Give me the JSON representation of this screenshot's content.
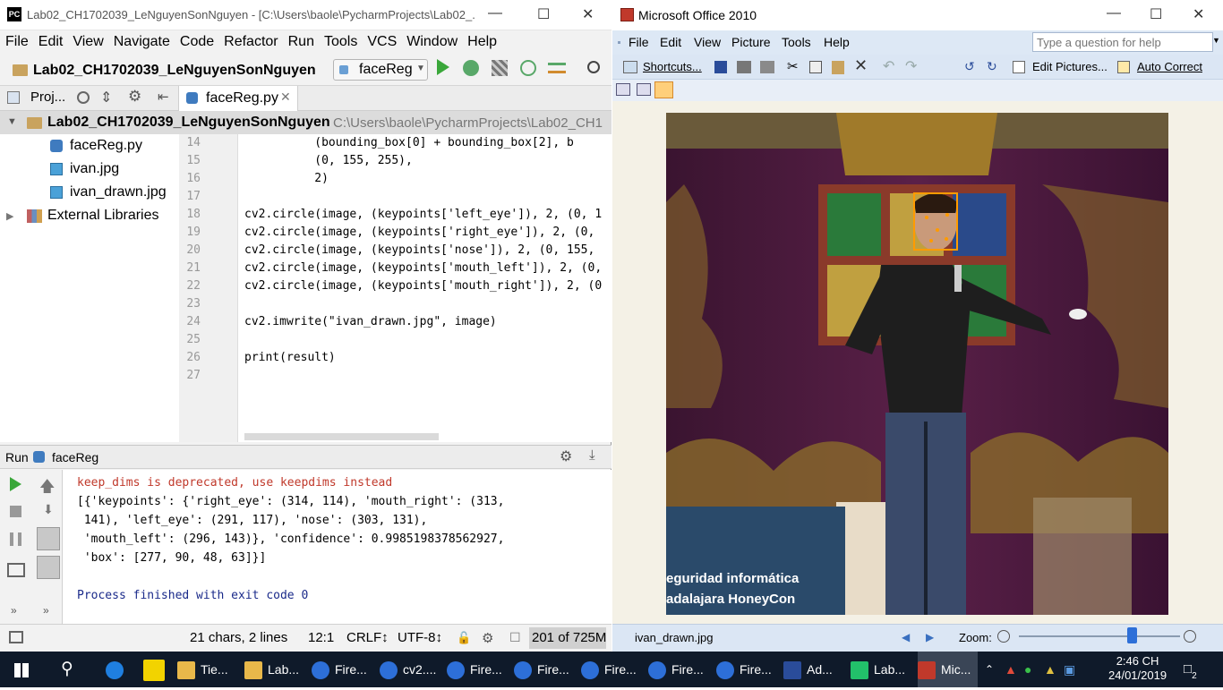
{
  "pycharm": {
    "title": "Lab02_CH1702039_LeNguyenSonNguyen - [C:\\Users\\baole\\PycharmProjects\\Lab02_...",
    "logo": "PC",
    "menu": [
      "File",
      "Edit",
      "View",
      "Navigate",
      "Code",
      "Refactor",
      "Run",
      "Tools",
      "VCS",
      "Window",
      "Help"
    ],
    "project_name": "Lab02_CH1702039_LeNguyenSonNguyen",
    "run_config": "faceReg",
    "proj_tab": "Proj...",
    "file_tab": "faceReg.py",
    "tree_root": "Lab02_CH1702039_LeNguyenSonNguyen",
    "tree_root_path": "C:\\Users\\baole\\PycharmProjects\\Lab02_CH1",
    "files": [
      "faceReg.py",
      "ivan.jpg",
      "ivan_drawn.jpg"
    ],
    "external": "External Libraries",
    "line_numbers": [
      "14",
      "15",
      "16",
      "17",
      "18",
      "19",
      "20",
      "21",
      "22",
      "23",
      "24",
      "25",
      "26",
      "27"
    ],
    "code_lines": [
      "          (bounding_box[0] + bounding_box[2], b",
      "          (0, 155, 255),",
      "          2)",
      "",
      "cv2.circle(image, (keypoints['left_eye']), 2, (0, 1",
      "cv2.circle(image, (keypoints['right_eye']), 2, (0,",
      "cv2.circle(image, (keypoints['nose']), 2, (0, 155,",
      "cv2.circle(image, (keypoints['mouth_left']), 2, (0,",
      "cv2.circle(image, (keypoints['mouth_right']), 2, (0",
      "",
      "cv2.imwrite(\"ivan_drawn.jpg\", image)",
      "",
      "print(result)",
      ""
    ],
    "run_label": "Run",
    "run_name": "faceReg",
    "console": [
      "keep_dims is deprecated, use keepdims instead",
      "[{'keypoints': {'right_eye': (314, 114), 'mouth_right': (313,",
      " 141), 'left_eye': (291, 117), 'nose': (303, 131),",
      " 'mouth_left': (296, 143)}, 'confidence': 0.9985198378562927,",
      " 'box': [277, 90, 48, 63]}]",
      "",
      "Process finished with exit code 0"
    ],
    "status": {
      "chars": "21 chars, 2 lines",
      "pos": "12:1",
      "crlf": "CRLF↕",
      "enc": "UTF-8↕",
      "mem": "201 of 725M"
    }
  },
  "office": {
    "title": "Microsoft Office 2010",
    "menu": [
      "File",
      "Edit",
      "View",
      "Picture",
      "Tools",
      "Help"
    ],
    "help_placeholder": "Type a question for help",
    "shortcuts": "Shortcuts...",
    "edit_pictures": "Edit Pictures...",
    "auto_correct": "Auto Correct",
    "banner_line1": "eguridad informática",
    "banner_line2": "adalajara HoneyCon",
    "filename": "ivan_drawn.jpg",
    "zoom_label": "Zoom:",
    "zoom_fraction": 0.7
  },
  "taskbar": {
    "items": [
      {
        "label": "Tie...",
        "icon": "folder-icon",
        "color": "#e8b84a"
      },
      {
        "label": "Lab...",
        "icon": "folder-icon",
        "color": "#e8b84a"
      },
      {
        "label": "Fire...",
        "icon": "firefox-icon",
        "color": "#2d6fd8"
      },
      {
        "label": "cv2....",
        "icon": "firefox-icon",
        "color": "#2d6fd8"
      },
      {
        "label": "Fire...",
        "icon": "firefox-icon",
        "color": "#2d6fd8"
      },
      {
        "label": "Fire...",
        "icon": "firefox-icon",
        "color": "#2d6fd8"
      },
      {
        "label": "Fire...",
        "icon": "firefox-icon",
        "color": "#2d6fd8"
      },
      {
        "label": "Fire...",
        "icon": "firefox-icon",
        "color": "#2d6fd8"
      },
      {
        "label": "Fire...",
        "icon": "firefox-icon",
        "color": "#2d6fd8"
      },
      {
        "label": "Ad...",
        "icon": "powershell-icon",
        "color": "#2a4c9a"
      },
      {
        "label": "Lab...",
        "icon": "pycharm-icon",
        "color": "#22c06a"
      },
      {
        "label": "Mic...",
        "icon": "picture-manager-icon",
        "color": "#c0392b"
      }
    ],
    "time": "2:46 CH",
    "date": "24/01/2019",
    "notif": "2"
  }
}
